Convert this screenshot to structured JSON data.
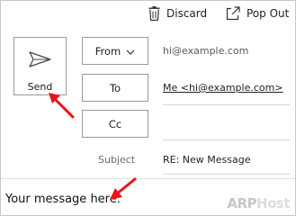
{
  "toolbar": {
    "discard_label": "Discard",
    "popout_label": "Pop Out"
  },
  "send": {
    "label": "Send"
  },
  "fields": {
    "from": {
      "button_label": "From",
      "value": "hi@example.com"
    },
    "to": {
      "button_label": "To",
      "value": "Me <hi@example.com>"
    },
    "cc": {
      "button_label": "Cc",
      "value": ""
    },
    "subject": {
      "label": "Subject",
      "value": "RE: New Message"
    }
  },
  "body": {
    "text": "Your message here."
  },
  "watermark": {
    "part1": "ARP",
    "part2": "Host"
  },
  "colors": {
    "annotation_arrow": "#e8141a",
    "watermark": "#cfcfcf",
    "border": "#9a9a9a"
  },
  "icons": [
    "trash-icon",
    "popout-icon",
    "send-paper-plane-icon",
    "chevron-down-icon"
  ]
}
